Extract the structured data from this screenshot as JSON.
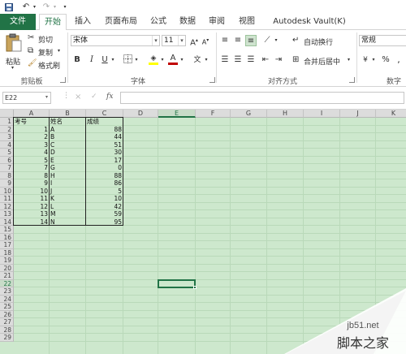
{
  "qat": {
    "save_icon": "save-icon",
    "undo_icon": "undo-icon",
    "redo_icon": "redo-icon"
  },
  "tabs": [
    {
      "label": "文件",
      "kind": "file"
    },
    {
      "label": "开始",
      "kind": "active"
    },
    {
      "label": "插入",
      "kind": ""
    },
    {
      "label": "页面布局",
      "kind": ""
    },
    {
      "label": "公式",
      "kind": ""
    },
    {
      "label": "数据",
      "kind": ""
    },
    {
      "label": "审阅",
      "kind": ""
    },
    {
      "label": "视图",
      "kind": ""
    },
    {
      "label": "Autodesk Vault(K)",
      "kind": ""
    }
  ],
  "ribbon": {
    "clipboard": {
      "paste": "粘贴",
      "cut": "剪切",
      "copy": "复制",
      "format_painter": "格式刷",
      "group": "剪贴板"
    },
    "font": {
      "name": "宋体",
      "size": "11",
      "bold": "B",
      "italic": "I",
      "underline": "U",
      "grow": "A",
      "shrink": "A",
      "group": "字体",
      "fill_color": "#ffff00",
      "font_color": "#c00000"
    },
    "alignment": {
      "wrap": "自动换行",
      "merge": "合并后居中",
      "group": "对齐方式"
    },
    "number": {
      "format": "常规",
      "percent": "%",
      "group": "数字"
    }
  },
  "formula_bar": {
    "name_box": "E22",
    "cancel": "×",
    "enter": "✓",
    "fx": "fx",
    "value": ""
  },
  "grid": {
    "columns": [
      "A",
      "B",
      "C",
      "D",
      "E",
      "F",
      "G",
      "H",
      "I",
      "J",
      "K"
    ],
    "selected_column": "E",
    "selected_row": 22,
    "rows": [
      "1",
      "2",
      "3",
      "4",
      "5",
      "6",
      "7",
      "8",
      "9",
      "10",
      "11",
      "12",
      "13",
      "14",
      "15",
      "16",
      "17",
      "18",
      "19",
      "20",
      "21",
      "22",
      "23",
      "24",
      "25",
      "26",
      "27",
      "28",
      "29"
    ],
    "headers": [
      "考号",
      "姓名",
      "成绩"
    ],
    "table": [
      [
        "1",
        "A",
        "88"
      ],
      [
        "2",
        "B",
        "44"
      ],
      [
        "3",
        "C",
        "51"
      ],
      [
        "4",
        "D",
        "30"
      ],
      [
        "5",
        "E",
        "17"
      ],
      [
        "7",
        "G",
        "0"
      ],
      [
        "8",
        "H",
        "88"
      ],
      [
        "9",
        "I",
        "86"
      ],
      [
        "10",
        "J",
        "5"
      ],
      [
        "11",
        "K",
        "10"
      ],
      [
        "12",
        "L",
        "42"
      ],
      [
        "13",
        "M",
        "59"
      ],
      [
        "14",
        "N",
        "95"
      ]
    ]
  },
  "watermark": {
    "site": "jb51.net",
    "brand": "脚本之家"
  },
  "colors": {
    "accent": "#217346",
    "grid_bg": "#cde8cd"
  }
}
